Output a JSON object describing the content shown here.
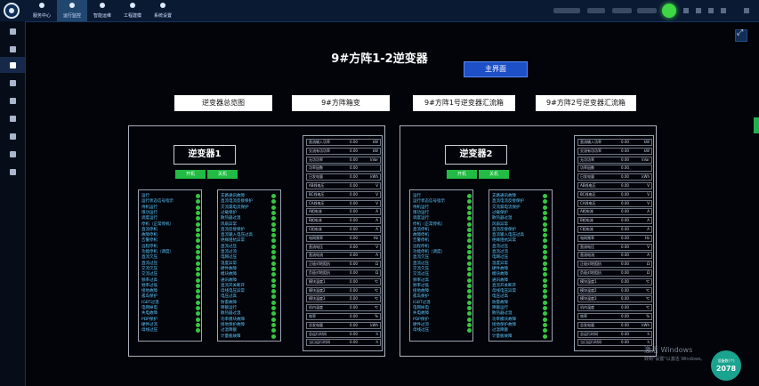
{
  "app": {
    "nav": [
      {
        "label": "服务中心",
        "icon": "service-icon",
        "active": false
      },
      {
        "label": "运行监控",
        "icon": "monitor-icon",
        "active": true
      },
      {
        "label": "智能运维",
        "icon": "maintenance-icon",
        "active": false
      },
      {
        "label": "工程建模",
        "icon": "modeling-icon",
        "active": false
      },
      {
        "label": "系统设置",
        "icon": "settings-icon",
        "active": false
      }
    ],
    "status_color": "#3dd843"
  },
  "page": {
    "title": "9#方阵1-2逆变器",
    "main_button": "主界面",
    "links": [
      "逆变器总览图",
      "9#方阵箱变",
      "9#方阵1号逆变器汇流箱",
      "9#方阵2号逆变器汇流箱"
    ]
  },
  "inverters": [
    {
      "title": "逆变器1",
      "start": "开机",
      "stop": "关机",
      "status_left": [
        "运行",
        "运行状态信号指示",
        "待机运行",
        "限功运行",
        "调度运行",
        "停机（正常停机）",
        "直流停机",
        "故障停机",
        "告警停机",
        "远程停机",
        "功能停机（调度）",
        "直流欠压",
        "直流过压",
        "交流欠压",
        "交流过压",
        "频率过高",
        "频率过低",
        "接地故障",
        "孤岛保护",
        "IGBT过温",
        "电网掉电",
        "失电故障",
        "PDP保护",
        "硬件过流",
        "母线过压"
      ],
      "status_right": [
        "支路通讯故障",
        "直流电流反接保护",
        "交流漏电流保护",
        "过载保护",
        "散热器过温",
        "风扇异常",
        "直流反接保护",
        "直流输入电压过高",
        "绝缘阻抗异常",
        "直流过压",
        "直流过流",
        "电网过压",
        "温度异常",
        "硬件故障",
        "模块故障",
        "通讯故障",
        "直流开关断开",
        "母线电压异常",
        "电压过高",
        "防雷故障",
        "降额运行",
        "散热器过温",
        "功率模块故障",
        "接地保护故障",
        "过温降额",
        "计量板故障"
      ]
    },
    {
      "title": "逆变器2",
      "start": "开机",
      "stop": "关机",
      "status_left": [
        "运行",
        "运行状态信号指示",
        "待机运行",
        "限功运行",
        "调度运行",
        "停机（正常停机）",
        "直流停机",
        "故障停机",
        "告警停机",
        "远程停机",
        "功能停机（调度）",
        "直流欠压",
        "直流过压",
        "交流欠压",
        "交流过压",
        "频率过高",
        "频率过低",
        "接地故障",
        "孤岛保护",
        "IGBT过温",
        "电网掉电",
        "失电故障",
        "PDP保护",
        "硬件过流",
        "母线过压"
      ],
      "status_right": [
        "支路通讯故障",
        "直流电流反接保护",
        "交流漏电流保护",
        "过载保护",
        "散热器过温",
        "风扇异常",
        "直流反接保护",
        "直流输入电压过高",
        "绝缘阻抗异常",
        "直流过压",
        "直流过流",
        "电网过压",
        "温度异常",
        "硬件故障",
        "模块故障",
        "通讯故障",
        "直流开关断开",
        "母线电压异常",
        "电压过高",
        "防雷故障",
        "降额运行",
        "散热器过温",
        "功率模块故障",
        "接地保护故障",
        "过温降额",
        "计量板故障"
      ]
    }
  ],
  "metrics": [
    {
      "label": "直流输入功率",
      "value": "0.00",
      "unit": "kW"
    },
    {
      "label": "交流有功功率",
      "value": "0.00",
      "unit": "kW"
    },
    {
      "label": "无功功率",
      "value": "0.00",
      "unit": "kVar"
    },
    {
      "label": "功率因数",
      "value": "0.00",
      "unit": ""
    },
    {
      "label": "日发电量",
      "value": "0.00",
      "unit": "kWh"
    },
    {
      "label": "AB线电压",
      "value": "0.00",
      "unit": "V"
    },
    {
      "label": "BC线电压",
      "value": "0.00",
      "unit": "V"
    },
    {
      "label": "CA线电压",
      "value": "0.00",
      "unit": "V"
    },
    {
      "label": "A相电流",
      "value": "0.00",
      "unit": "A"
    },
    {
      "label": "B相电流",
      "value": "0.00",
      "unit": "A"
    },
    {
      "label": "C相电流",
      "value": "0.00",
      "unit": "A"
    },
    {
      "label": "电网频率",
      "value": "0.00",
      "unit": "Hz"
    },
    {
      "label": "直流电压",
      "value": "0.00",
      "unit": "V"
    },
    {
      "label": "直流电流",
      "value": "0.00",
      "unit": "A"
    },
    {
      "label": "正极对地阻抗",
      "value": "0.00",
      "unit": "Ω"
    },
    {
      "label": "负极对地阻抗",
      "value": "0.00",
      "unit": "Ω"
    },
    {
      "label": "模块温度1",
      "value": "0.00",
      "unit": "℃"
    },
    {
      "label": "模块温度2",
      "value": "0.00",
      "unit": "℃"
    },
    {
      "label": "模块温度3",
      "value": "0.00",
      "unit": "℃"
    },
    {
      "label": "机内温度",
      "value": "0.00",
      "unit": "℃"
    },
    {
      "label": "效率",
      "value": "0.00",
      "unit": "%"
    },
    {
      "label": "总发电量",
      "value": "0.00",
      "unit": "kWh"
    },
    {
      "label": "总运行时间",
      "value": "0.00",
      "unit": "h"
    },
    {
      "label": "当日运行时间",
      "value": "0.00",
      "unit": "h"
    }
  ],
  "watermark": {
    "line1": "激活 Windows",
    "line2": "转到\"设置\"以激活 Windows。"
  },
  "badge": {
    "line1": "设备数(个)",
    "line2": "2078"
  }
}
